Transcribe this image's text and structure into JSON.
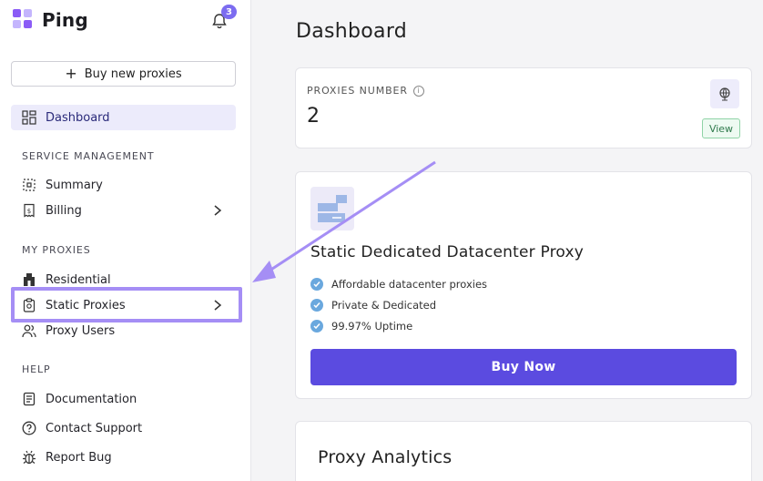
{
  "app": {
    "name": "Ping",
    "notification_count": "3"
  },
  "sidebar": {
    "buy_button_label": "Buy new proxies",
    "dashboard_label": "Dashboard",
    "sections": {
      "service_management": "SERVICE MANAGEMENT",
      "my_proxies": "MY PROXIES",
      "help": "HELP"
    },
    "items": {
      "summary": "Summary",
      "billing": "Billing",
      "residential": "Residential",
      "static_proxies": "Static Proxies",
      "proxy_users": "Proxy Users",
      "documentation": "Documentation",
      "contact_support": "Contact Support",
      "report_bug": "Report Bug"
    }
  },
  "main": {
    "title": "Dashboard",
    "proxies_card": {
      "label": "PROXIES NUMBER",
      "value": "2",
      "view_label": "View"
    },
    "offer_card": {
      "title": "Static Dedicated Datacenter Proxy",
      "features": [
        "Affordable datacenter proxies",
        "Private & Dedicated",
        "99.97% Uptime"
      ],
      "buy_label": "Buy Now"
    },
    "analytics_title": "Proxy Analytics"
  },
  "colors": {
    "accent": "#5b4be0",
    "highlight": "#a58ef5",
    "active_bg": "#ecebfb"
  }
}
